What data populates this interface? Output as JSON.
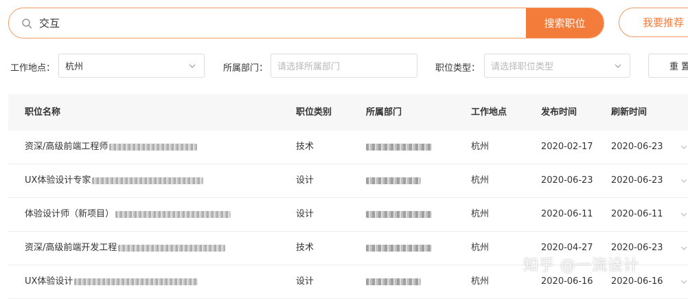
{
  "search": {
    "query": "交互",
    "button_label": "搜索职位"
  },
  "recommend_label": "我要推荐",
  "filters": {
    "location": {
      "label": "工作地点：",
      "value": "杭州"
    },
    "department": {
      "label": "所属部门：",
      "placeholder": "请选择所属部门"
    },
    "job_type": {
      "label": "职位类型：",
      "placeholder": "请选择职位类型"
    },
    "reset_label": "重 置"
  },
  "table": {
    "columns": [
      "职位名称",
      "职位类别",
      "所属部门",
      "工作地点",
      "发布时间",
      "刷新时间"
    ],
    "rows": [
      {
        "name": "资深/高级前端工程师",
        "category": "技术",
        "location": "杭州",
        "published": "2020-02-17",
        "refreshed": "2020-06-23"
      },
      {
        "name": "UX体验设计专家",
        "category": "设计",
        "location": "杭州",
        "published": "2020-06-23",
        "refreshed": "2020-06-23"
      },
      {
        "name": "体验设计师（新项目）",
        "category": "设计",
        "location": "杭州",
        "published": "2020-06-11",
        "refreshed": "2020-06-11"
      },
      {
        "name": "资深/高级前端开发工程",
        "category": "技术",
        "location": "杭州",
        "published": "2020-04-27",
        "refreshed": "2020-06-23"
      },
      {
        "name": "UX体验设计",
        "category": "设计",
        "location": "杭州",
        "published": "2020-06-16",
        "refreshed": "2020-06-16"
      }
    ]
  },
  "watermark": "知乎 @一流设计",
  "colors": {
    "accent": "#f47c3b",
    "accent_border": "#f29a61",
    "header_bg": "#f7f7f7"
  },
  "icons": {
    "search": "search-icon",
    "dropdown": "chevron-down-icon"
  }
}
